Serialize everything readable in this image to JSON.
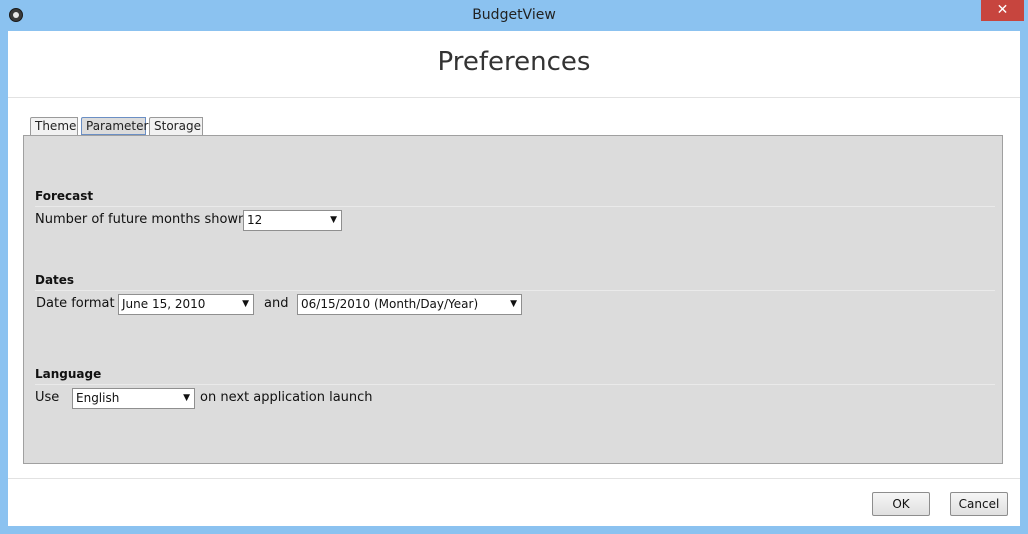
{
  "window": {
    "title": "BudgetView",
    "close_label": "✕"
  },
  "header": {
    "title": "Preferences"
  },
  "tabs": [
    {
      "label": "Theme"
    },
    {
      "label": "Parameters"
    },
    {
      "label": "Storage"
    }
  ],
  "forecast": {
    "title": "Forecast",
    "label": "Number of future months shown",
    "value": "12"
  },
  "dates": {
    "title": "Dates",
    "label": "Date format",
    "format1": "June 15, 2010",
    "and_label": "and",
    "format2": "06/15/2010 (Month/Day/Year)"
  },
  "language": {
    "title": "Language",
    "use_label": "Use",
    "value": "English",
    "suffix": "on next application launch"
  },
  "footer": {
    "ok_label": "OK",
    "cancel_label": "Cancel"
  },
  "icons": {
    "app": "app-icon",
    "dropdown": "chevron-down-icon",
    "close": "close-icon"
  }
}
